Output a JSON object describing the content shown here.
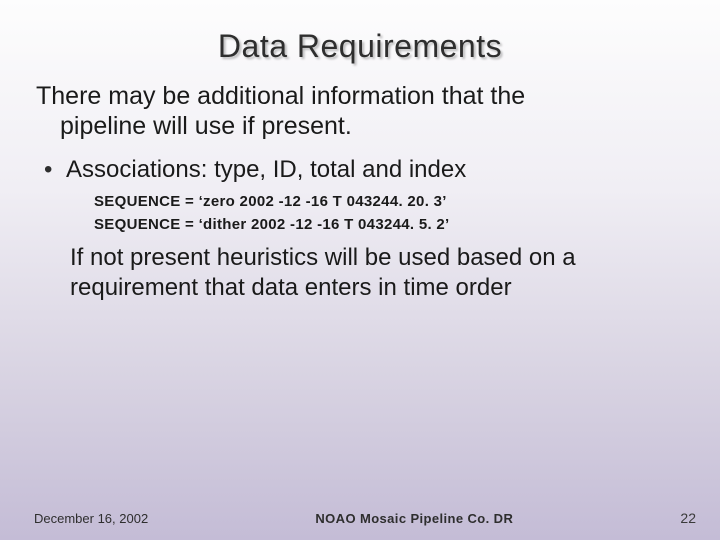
{
  "title": "Data Requirements",
  "intro_line1": "There may be additional information that the",
  "intro_line2": "pipeline will use if present.",
  "bullet1": "Associations: type, ID, total and index",
  "sequence1": "SEQUENCE = ‘zero 2002 -12 -16 T 043244. 20. 3’",
  "sequence2": "SEQUENCE = ‘dither 2002 -12 -16 T 043244. 5. 2’",
  "followup": "If not present heuristics will be used based on a requirement that data enters in time order",
  "footer": {
    "date": "December 16, 2002",
    "center": "NOAO Mosaic Pipeline Co. DR",
    "page": "22"
  }
}
